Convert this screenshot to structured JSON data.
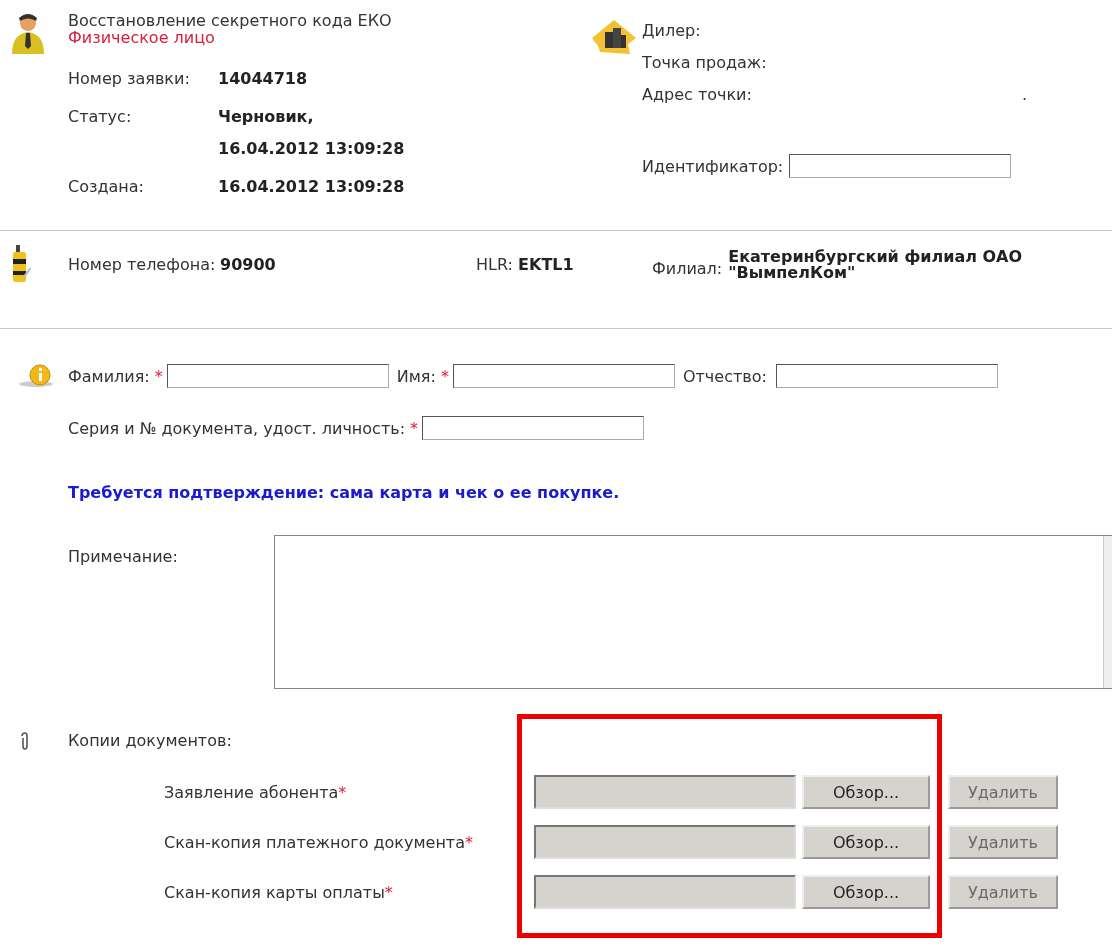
{
  "request": {
    "title": "Восстановление секретного кода ЕКО",
    "client_type": "Физическое лицо",
    "fields": [
      {
        "label": "Номер заявки:",
        "lines": [
          "14044718"
        ]
      },
      {
        "label": "Статус:",
        "lines": [
          "Черновик,",
          "16.04.2012 13:09:28"
        ]
      },
      {
        "label": "Создана:",
        "lines": [
          "16.04.2012 13:09:28"
        ]
      }
    ]
  },
  "dealer": {
    "fields": [
      {
        "label": "Дилер:"
      },
      {
        "label": "Точка продаж:"
      },
      {
        "label": "Адрес точки:",
        "value": "."
      }
    ],
    "identifier": {
      "label": "Идентификатор:"
    }
  },
  "phone": {
    "phone_label": "Номер телефона:",
    "phone": "90900",
    "hlr_label": "HLR:",
    "hlr": "EKTL1",
    "branch_label": "Филиал:",
    "branch": "Екатеринбургский филиал ОАО \"ВымпелКом\""
  },
  "person": {
    "rows": [
      [
        {
          "label": "Фамилия:",
          "required_mark": "*"
        },
        {
          "label": "Имя:",
          "required_mark": "*"
        },
        {
          "label": "Отчество:"
        }
      ],
      [
        {
          "label": "Серия и № документа, удост. личность:",
          "required_mark": "*"
        }
      ]
    ]
  },
  "notice": "Требуется подтверждение: сама карта и чек о ее покупке.",
  "note": {
    "label": "Примечание:"
  },
  "attachments": {
    "label": "Копии документов:",
    "highlighted": true,
    "files": [
      {
        "label": "Заявление абонента",
        "required_mark": "*",
        "browse": "Обзор...",
        "delete": "Удалить",
        "delete_disabled": true
      },
      {
        "label": "Скан-копия платежного документа",
        "required_mark": "*",
        "browse": "Обзор...",
        "delete": "Удалить",
        "delete_disabled": true
      },
      {
        "label": "Скан-копия карты оплаты",
        "required_mark": "*",
        "browse": "Обзор...",
        "delete": "Удалить",
        "delete_disabled": true
      }
    ]
  }
}
